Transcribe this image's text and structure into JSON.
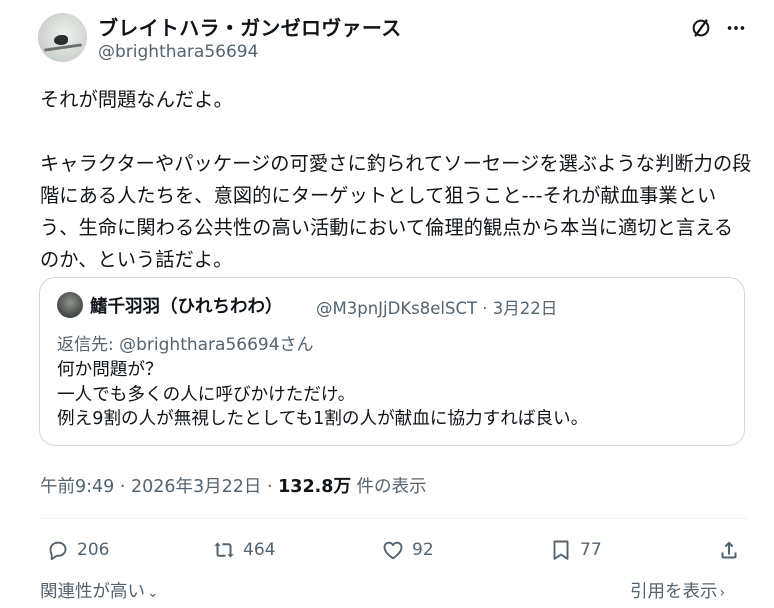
{
  "author": {
    "display_name": "ブレイトハラ・ガンゼロヴァース",
    "handle": "@brighthara56694"
  },
  "header_icons": [
    "grok-icon",
    "more-icon"
  ],
  "post": {
    "text": "それが問題なんだよ。\n\nキャラクターやパッケージの可愛さに釣られてソーセージを選ぶような判断力の段階にある人たちを、意図的にターゲットとして狙うこと---それが献血事業という、生命に関わる公共性の高い活動において倫理的観点から本当に適切と言えるのか、という話だよ。"
  },
  "quoted_post": {
    "display_name": "鰭千羽羽（ひれちわわ）",
    "meta": "@M3pnJjDKs8elSCT · 3月22日",
    "reply_to": "返信先: @brighthara56694さん",
    "text": "何か問題が？\n一人でも多くの人に呼びかけただけ。\n例え9割の人が無視したとしても1割の人が献血に協力すれば良い。"
  },
  "timestamp": {
    "time_date": "午前9:49 · 2026年3月22日 · ",
    "views_count": "132.8万",
    "views_label": " 件の表示"
  },
  "actions": {
    "replies": "206",
    "reposts": "464",
    "likes": "92",
    "bookmarks": "77"
  },
  "footer": {
    "sort_label": "関連性が高い",
    "quotes_label": "引用を表示"
  },
  "colors": {
    "text_primary": "#0f1419",
    "text_secondary": "#536471",
    "border": "#cfd9de"
  }
}
